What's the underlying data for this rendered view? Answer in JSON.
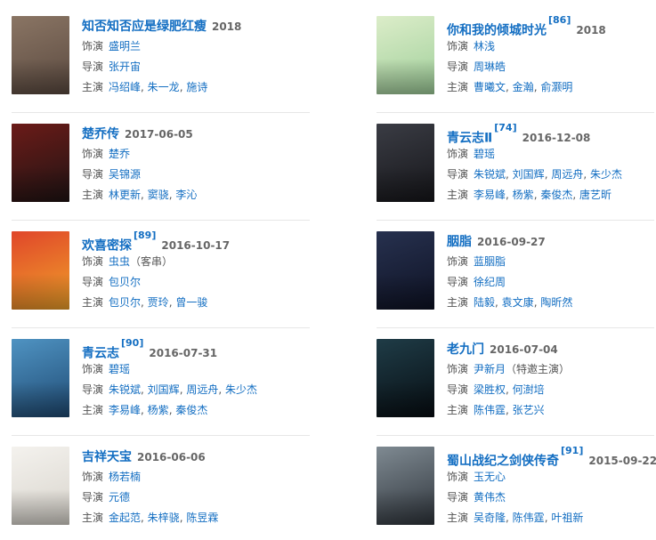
{
  "labels": {
    "role": "饰演",
    "director": "导演",
    "cast": "主演"
  },
  "cards": [
    {
      "title": "知否知否应是绿肥红瘦",
      "ref": "",
      "date": "2018",
      "role": [
        "盛明兰"
      ],
      "role_note": "",
      "director": [
        "张开宙"
      ],
      "cast": [
        "冯绍峰",
        "朱一龙",
        "施诗"
      ],
      "poster_colors": [
        "#8a7564",
        "#5b4a40"
      ]
    },
    {
      "title": "你和我的倾城时光",
      "ref": "[86]",
      "date": "2018",
      "role": [
        "林浅"
      ],
      "role_note": "",
      "director": [
        "周琳皓"
      ],
      "cast": [
        "曹曦文",
        "金瀚",
        "俞灏明"
      ],
      "poster_colors": [
        "#dcedc9",
        "#9fcf9a"
      ]
    },
    {
      "title": "楚乔传",
      "ref": "",
      "date": "2017-06-05",
      "role": [
        "楚乔"
      ],
      "role_note": "",
      "director": [
        "吴锦源"
      ],
      "cast": [
        "林更新",
        "窦骁",
        "李沁"
      ],
      "poster_colors": [
        "#6b1b18",
        "#201414"
      ]
    },
    {
      "title": "青云志Ⅱ",
      "ref": "[74]",
      "date": "2016-12-08",
      "role": [
        "碧瑶"
      ],
      "role_note": "",
      "director": [
        "朱锐斌",
        "刘国辉",
        "周远舟",
        "朱少杰"
      ],
      "cast": [
        "李易峰",
        "杨紫",
        "秦俊杰",
        "唐艺昕"
      ],
      "poster_colors": [
        "#3a3c44",
        "#16161a"
      ]
    },
    {
      "title": "欢喜密探",
      "ref": "[89]",
      "date": "2016-10-17",
      "role": [
        "虫虫"
      ],
      "role_note": "（客串）",
      "director": [
        "包贝尔"
      ],
      "cast": [
        "包贝尔",
        "贾玲",
        "曾一骏"
      ],
      "poster_colors": [
        "#e0462a",
        "#f0a22a"
      ]
    },
    {
      "title": "胭脂",
      "ref": "",
      "date": "2016-09-27",
      "role": [
        "蓝胭脂"
      ],
      "role_note": "",
      "director": [
        "徐纪周"
      ],
      "cast": [
        "陆毅",
        "袁文康",
        "陶昕然"
      ],
      "poster_colors": [
        "#27314f",
        "#0e1224"
      ]
    },
    {
      "title": "青云志",
      "ref": "[90]",
      "date": "2016-07-31",
      "role": [
        "碧瑶"
      ],
      "role_note": "",
      "director": [
        "朱锐斌",
        "刘国辉",
        "周远舟",
        "朱少杰"
      ],
      "cast": [
        "李易峰",
        "杨紫",
        "秦俊杰"
      ],
      "poster_colors": [
        "#4f93c2",
        "#1f4a73"
      ]
    },
    {
      "title": "老九门",
      "ref": "",
      "date": "2016-07-04",
      "role": [
        "尹新月"
      ],
      "role_note": "（特邀主演）",
      "director": [
        "梁胜权",
        "何澍培"
      ],
      "cast": [
        "陈伟霆",
        "张艺兴"
      ],
      "poster_colors": [
        "#1f3c47",
        "#070d12"
      ]
    },
    {
      "title": "吉祥天宝",
      "ref": "",
      "date": "2016-06-06",
      "role": [
        "杨若楠"
      ],
      "role_note": "",
      "director": [
        "元德"
      ],
      "cast": [
        "金起范",
        "朱梓骁",
        "陈昱霖"
      ],
      "poster_colors": [
        "#f4f2ee",
        "#d8d4cc"
      ]
    },
    {
      "title": "蜀山战纪之剑侠传奇",
      "ref": "[91]",
      "date": "2015-09-22",
      "role": [
        "玉无心"
      ],
      "role_note": "",
      "director": [
        "黄伟杰"
      ],
      "cast": [
        "吴奇隆",
        "陈伟霆",
        "叶祖新"
      ],
      "poster_colors": [
        "#7f8a92",
        "#2f353c"
      ]
    }
  ]
}
